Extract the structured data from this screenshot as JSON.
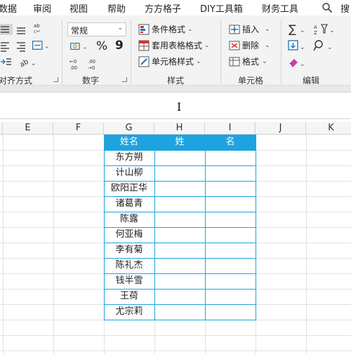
{
  "menu": {
    "tabs": [
      "数据",
      "审阅",
      "视图",
      "帮助",
      "方方格子",
      "DIY工具箱",
      "财务工具"
    ],
    "search": "搜"
  },
  "ribbon": {
    "alignment": {
      "label": "对齐方式"
    },
    "number": {
      "label": "数字",
      "format_value": "常规",
      "percent": "%",
      "comma": "9"
    },
    "styles": {
      "label": "样式",
      "conditional": "条件格式",
      "table_format": "套用表格格式",
      "cell_styles": "单元格样式"
    },
    "cells": {
      "label": "单元格",
      "insert": "插入",
      "delete": "删除",
      "format": "格式"
    },
    "editing": {
      "label": "编辑"
    }
  },
  "sheet": {
    "columns": [
      "E",
      "F",
      "G",
      "H",
      "I",
      "J",
      "K"
    ],
    "header": [
      "姓名",
      "姓",
      "名"
    ],
    "names": [
      "东方朔",
      "计山柳",
      "欧阳正华",
      "诸葛青",
      "陈露",
      "何亚梅",
      "李有菊",
      "陈礼杰",
      "钱半雪",
      "王荷",
      "尤宗莉"
    ]
  },
  "colors": {
    "accent": "#1ea3e0"
  }
}
